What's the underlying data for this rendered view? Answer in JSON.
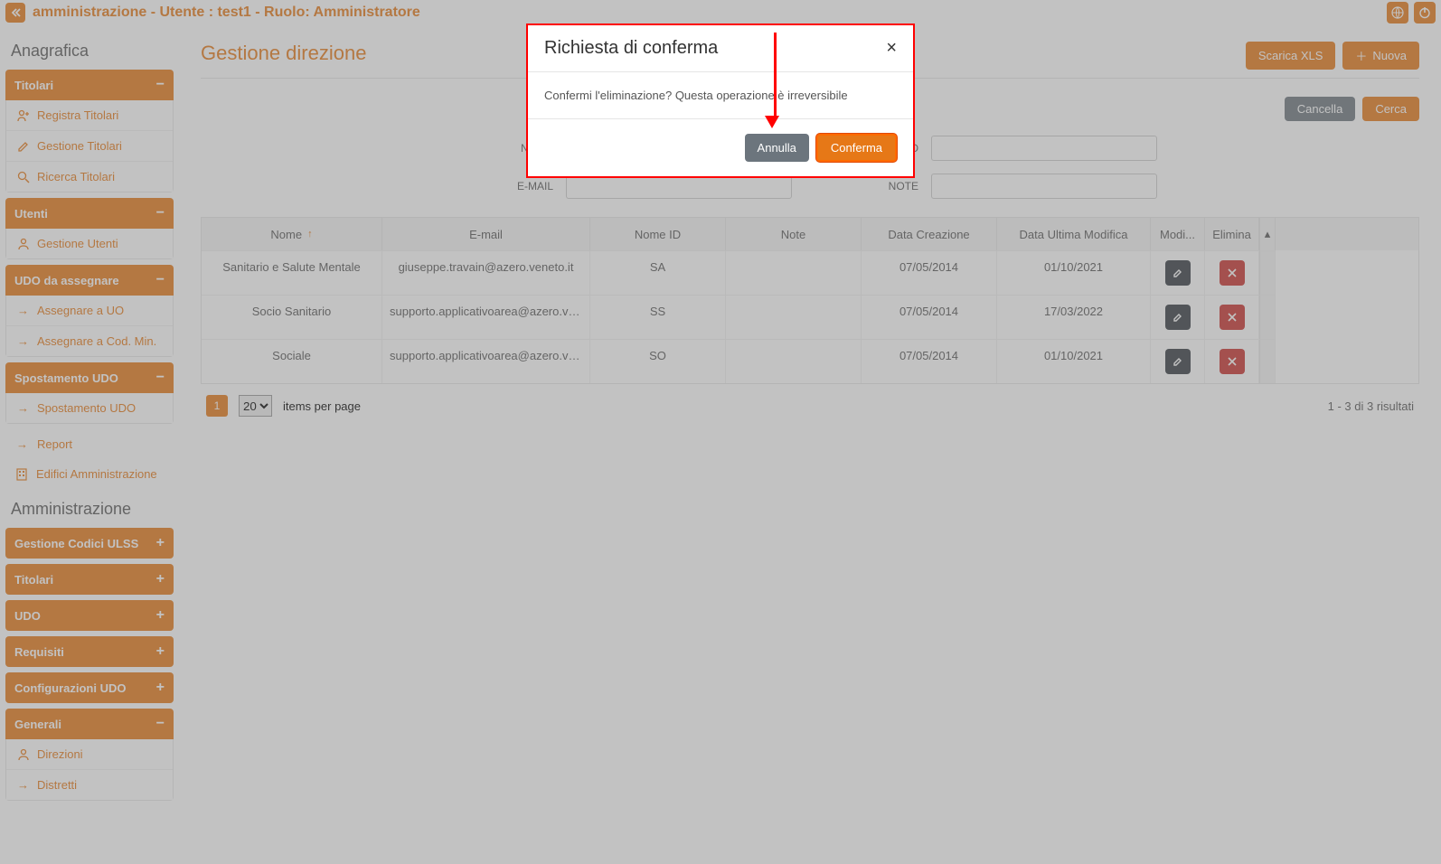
{
  "topbar": {
    "title": "amministrazione - Utente : test1 - Ruolo: Amministratore"
  },
  "sidebar": {
    "section1": "Anagrafica",
    "titolari": {
      "header": "Titolari",
      "items": [
        {
          "label": "Registra Titolari"
        },
        {
          "label": "Gestione Titolari"
        },
        {
          "label": "Ricerca Titolari"
        }
      ]
    },
    "utenti": {
      "header": "Utenti",
      "items": [
        {
          "label": "Gestione Utenti"
        }
      ]
    },
    "udo_assegnare": {
      "header": "UDO da assegnare",
      "items": [
        {
          "label": "Assegnare a UO"
        },
        {
          "label": "Assegnare a Cod. Min."
        }
      ]
    },
    "spostamento": {
      "header": "Spostamento UDO",
      "items": [
        {
          "label": "Spostamento UDO"
        }
      ]
    },
    "links": [
      {
        "label": "Report"
      },
      {
        "label": "Edifici Amministrazione"
      }
    ],
    "section2": "Amministrazione",
    "closed_panels": [
      "Gestione Codici ULSS",
      "Titolari",
      "UDO",
      "Requisiti",
      "Configurazioni UDO"
    ],
    "generali": {
      "header": "Generali",
      "items": [
        {
          "label": "Direzioni"
        },
        {
          "label": "Distretti"
        }
      ]
    }
  },
  "main": {
    "title": "Gestione direzione",
    "actions": {
      "xls": "Scarica XLS",
      "nuova": "Nuova"
    },
    "search": {
      "cancel": "Cancella",
      "search": "Cerca"
    },
    "filters": {
      "nome": "NOME",
      "nome_id": "NOME ID",
      "email": "E-MAIL",
      "note": "NOTE"
    },
    "grid": {
      "headers": [
        "Nome",
        "E-mail",
        "Nome ID",
        "Note",
        "Data Creazione",
        "Data Ultima Modifica",
        "Modi...",
        "Elimina"
      ],
      "rows": [
        {
          "nome": "Sanitario e Salute Mentale",
          "email": "giuseppe.travain@azero.veneto.it",
          "nome_id": "SA",
          "note": "",
          "creata": "07/05/2014",
          "modificata": "01/10/2021"
        },
        {
          "nome": "Socio Sanitario",
          "email": "supporto.applicativoarea@azero.vene...",
          "nome_id": "SS",
          "note": "",
          "creata": "07/05/2014",
          "modificata": "17/03/2022"
        },
        {
          "nome": "Sociale",
          "email": "supporto.applicativoarea@azero.vene...",
          "nome_id": "SO",
          "note": "",
          "creata": "07/05/2014",
          "modificata": "01/10/2021"
        }
      ]
    },
    "paginator": {
      "page": "1",
      "per_page": "20",
      "per_page_label": "items per page",
      "info": "1 - 3 di 3 risultati"
    }
  },
  "modal": {
    "title": "Richiesta di conferma",
    "body": "Confermi l'eliminazione? Questa operazione è irreversibile",
    "cancel": "Annulla",
    "confirm": "Conferma"
  }
}
